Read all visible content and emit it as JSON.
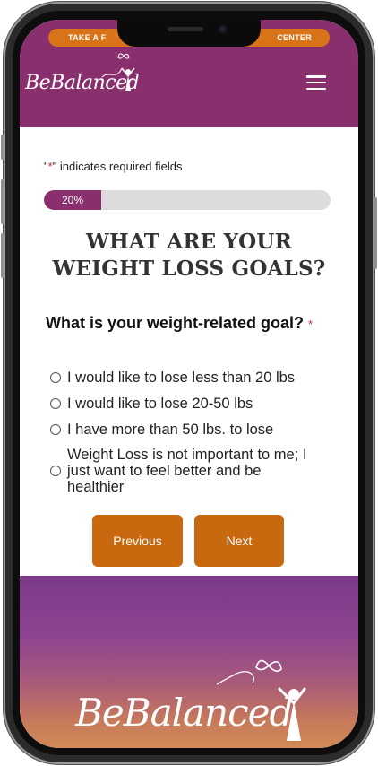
{
  "header": {
    "pill_left": "TAKE A F",
    "pill_right": "CENTER",
    "logo_text": "BeBalanced"
  },
  "form": {
    "required_note": "indicates required fields",
    "required_mark": "*",
    "progress_label": "20%",
    "progress_value": 0.2,
    "heading_line1": "WHAT ARE YOUR",
    "heading_line2": "WEIGHT LOSS GOALS?",
    "question": "What is your weight-related goal?",
    "options": [
      "I would like to lose less than 20 lbs",
      "I would like to lose 20-50 lbs",
      "I have more than 50 lbs. to lose",
      "Weight Loss is not important to me; I just want to feel better and be healthier"
    ],
    "prev_label": "Previous",
    "next_label": "Next"
  },
  "footer": {
    "logo_text": "BeBalanced"
  },
  "colors": {
    "brand_purple": "#8a2f6e",
    "brand_orange": "#c8680f"
  }
}
